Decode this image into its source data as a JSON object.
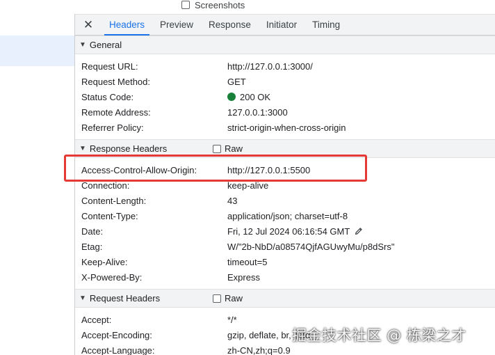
{
  "screenshots_label": "Screenshots",
  "tabs": [
    "Headers",
    "Preview",
    "Response",
    "Initiator",
    "Timing"
  ],
  "general": {
    "title": "General",
    "rows": [
      {
        "key": "Request URL:",
        "value": "http://127.0.0.1:3000/"
      },
      {
        "key": "Request Method:",
        "value": "GET"
      },
      {
        "key": "Status Code:",
        "value": "200 OK"
      },
      {
        "key": "Remote Address:",
        "value": "127.0.0.1:3000"
      },
      {
        "key": "Referrer Policy:",
        "value": "strict-origin-when-cross-origin"
      }
    ]
  },
  "response_headers": {
    "title": "Response Headers",
    "raw_label": "Raw",
    "rows": [
      {
        "key": "Access-Control-Allow-Origin:",
        "value": "http://127.0.0.1:5500"
      },
      {
        "key": "Connection:",
        "value": "keep-alive"
      },
      {
        "key": "Content-Length:",
        "value": "43"
      },
      {
        "key": "Content-Type:",
        "value": "application/json; charset=utf-8"
      },
      {
        "key": "Date:",
        "value": "Fri, 12 Jul 2024 06:16:54 GMT"
      },
      {
        "key": "Etag:",
        "value": "W/\"2b-NbD/a08574QjfAGUwyMu/p8dSrs\""
      },
      {
        "key": "Keep-Alive:",
        "value": "timeout=5"
      },
      {
        "key": "X-Powered-By:",
        "value": "Express"
      }
    ]
  },
  "request_headers": {
    "title": "Request Headers",
    "raw_label": "Raw",
    "rows": [
      {
        "key": "Accept:",
        "value": "*/*"
      },
      {
        "key": "Accept-Encoding:",
        "value": "gzip, deflate, br, zstd"
      },
      {
        "key": "Accept-Language:",
        "value": "zh-CN,zh;q=0.9"
      }
    ]
  },
  "status_color": "#188038",
  "accent_color": "#1a73e8",
  "highlight_color": "#e53935",
  "watermark": "掘金技术社区 @ 栋梁之才"
}
